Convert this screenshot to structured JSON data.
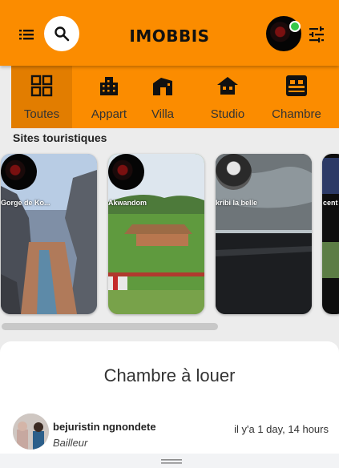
{
  "app": {
    "title": "IMOBBIS"
  },
  "header": {
    "menu_icon": "menu-icon",
    "search_icon": "search-icon",
    "profile_status_color": "#35c84a",
    "filter_icon": "tune-icon",
    "accent": "#fb8c00"
  },
  "categories": [
    {
      "label": "Toutes",
      "icon": "grid-icon",
      "active": true
    },
    {
      "label": "Appart",
      "icon": "apartment-icon",
      "active": false
    },
    {
      "label": "Villa",
      "icon": "villa-icon",
      "active": false
    },
    {
      "label": "Studio",
      "icon": "house-icon",
      "active": false
    },
    {
      "label": "Chambre",
      "icon": "bed-icon",
      "active": false
    }
  ],
  "sites": {
    "title": "Sites touristiques",
    "items": [
      {
        "caption": "Gorge de Ko..."
      },
      {
        "caption": "Akwandom"
      },
      {
        "caption": "kribi la belle"
      },
      {
        "caption": "cent"
      }
    ]
  },
  "listing": {
    "title": "Chambre à louer",
    "owner_name": "bejuristin ngnondete",
    "owner_role": "Bailleur",
    "time_ago": "il y'a 1 day, 14 hours"
  }
}
